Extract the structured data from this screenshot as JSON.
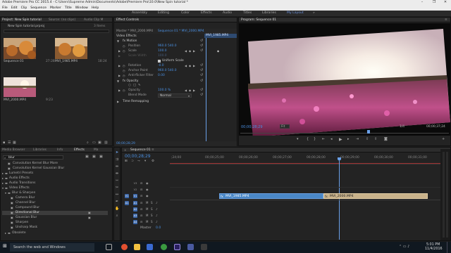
{
  "window": {
    "title": "Adobe Premiere Pro CC 2015.4 - C:\\Users\\Supreme Admin\\Documents\\Adobe\\Premiere Pro\\10.0\\New Spin tutorial *",
    "controls": [
      "–",
      "❐",
      "✕"
    ]
  },
  "menu": [
    "File",
    "Edit",
    "Clip",
    "Sequence",
    "Marker",
    "Title",
    "Window",
    "Help"
  ],
  "workspaces": [
    "Assembly",
    "Editing",
    "Color",
    "Effects",
    "Audio",
    "Titles",
    "Libraries",
    "My Layout"
  ],
  "workspaces_more": "»",
  "project": {
    "tabs": [
      "Project: New Spin tutorial",
      "Source: (no clips)",
      "Audio Clip M"
    ],
    "file": "New Spin tutorial.prproj",
    "items_count": "3 Items",
    "items": [
      {
        "name": "Sequence 01",
        "dur": "27:28"
      },
      {
        "name": "MVI_1985.MP4",
        "dur": "18:24"
      },
      {
        "name": "MVI_2000.MP4",
        "dur": "9:23"
      }
    ]
  },
  "effect_controls": {
    "tab": "Effect Controls",
    "master": "Master * MVI_2000.MP4",
    "sequence": "Sequence 01 * MVI_2000.MP4",
    "clip_label": "MVI_1985.MP4",
    "section": "Video Effects",
    "rows": [
      {
        "name": "fx  Motion",
        "value": ""
      },
      {
        "name": "Position",
        "value": "960.0   540.0"
      },
      {
        "name": "Scale",
        "value": "100.0"
      },
      {
        "name": "Scale Width",
        "value": "100.0"
      },
      {
        "name": "Uniform Scale",
        "value": ""
      },
      {
        "name": "Rotation",
        "value": "-0.0"
      },
      {
        "name": "Anchor Point",
        "value": "960.0   540.0"
      },
      {
        "name": "Anti-flicker Filter",
        "value": "0.00"
      },
      {
        "name": "fx  Opacity",
        "value": ""
      },
      {
        "name": "Opacity",
        "value": "100.0 %"
      },
      {
        "name": "Blend Mode",
        "value": "Normal"
      },
      {
        "name": "Time Remapping",
        "value": ""
      }
    ],
    "timecode": "00;00;28;29"
  },
  "program": {
    "title": "Program: Sequence 01",
    "timecode": "00;00;28;29",
    "fit": "Fit",
    "quality": "1/4",
    "duration": "00;00;37;24"
  },
  "effects_panel": {
    "tabs": [
      "Media Browser",
      "Libraries",
      "Info",
      "Effects",
      "Ma"
    ],
    "search": "blur",
    "items": [
      {
        "label": "Convolution Kernel Blur More",
        "indent": 2,
        "sel": false
      },
      {
        "label": "Convolution Kernel Gaussian Blur",
        "indent": 2,
        "sel": false
      },
      {
        "label": "Lumetri Presets",
        "indent": 0,
        "sel": false
      },
      {
        "label": "Audio Effects",
        "indent": 0,
        "sel": false
      },
      {
        "label": "Audio Transitions",
        "indent": 0,
        "sel": false
      },
      {
        "label": "Video Effects",
        "indent": 0,
        "sel": false
      },
      {
        "label": "Blur & Sharpen",
        "indent": 1,
        "sel": false
      },
      {
        "label": "Camera Blur",
        "indent": 2,
        "sel": false
      },
      {
        "label": "Channel Blur",
        "indent": 2,
        "sel": false
      },
      {
        "label": "Compound Blur",
        "indent": 2,
        "sel": false
      },
      {
        "label": "Directional Blur",
        "indent": 2,
        "sel": true
      },
      {
        "label": "Gaussian Blur",
        "indent": 2,
        "sel": false
      },
      {
        "label": "Sharpen",
        "indent": 2,
        "sel": false
      },
      {
        "label": "Unsharp Mask",
        "indent": 2,
        "sel": false
      },
      {
        "label": "Obsolete",
        "indent": 1,
        "sel": false
      }
    ]
  },
  "timeline": {
    "tab": "Sequence 01",
    "timecode": "00;00;28;29",
    "ruler": [
      ";24;00",
      "00;00;25;00",
      "00;00;26;00",
      "00;00;27;00",
      "00;00;28;00",
      "00;00;29;00",
      "00;00;30;00",
      "00;00;31;00"
    ],
    "tracks": [
      {
        "name": "V3",
        "src": ""
      },
      {
        "name": "V2",
        "src": ""
      },
      {
        "name": "V1",
        "src": "V1"
      },
      {
        "name": "A1",
        "src": "A1"
      },
      {
        "name": "A2",
        "src": ""
      },
      {
        "name": "A3",
        "src": ""
      },
      {
        "name": "A4",
        "src": ""
      }
    ],
    "master": "Master",
    "master_val": "0.0",
    "clips": [
      {
        "label": "MVI_1985.MP4"
      },
      {
        "label": "MVI_2000.MP4"
      }
    ]
  },
  "taskbar": {
    "search": "Search the web and Windows",
    "time": "5:01 PM",
    "date": "11/4/2016"
  },
  "colors": {
    "accent": "#4a8fe0",
    "clip_blue": "#4a87c6",
    "clip_tan": "#c9b28a",
    "playhead": "#6aa0e8"
  }
}
